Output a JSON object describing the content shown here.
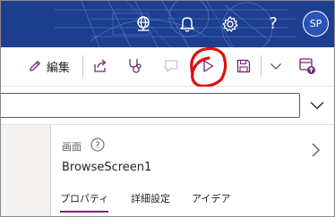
{
  "header": {
    "background": "#1e3f90",
    "icons": [
      "environment-globe-icon",
      "notification-bell-icon",
      "settings-gear-icon",
      "help-question-icon"
    ],
    "help_glyph": "?",
    "avatar_initials": "SP"
  },
  "command_bar": {
    "edit_label": "編集",
    "icons": [
      "edit-pencil-icon",
      "share-icon",
      "app-checker-stethoscope-icon",
      "comments-icon",
      "preview-play-icon",
      "save-icon",
      "more-chevron-down-icon",
      "publish-icon"
    ],
    "accent": "#742774",
    "annotation_color": "#e01010"
  },
  "formula_bar": {
    "value": "",
    "expand_icon": "chevron-down-icon"
  },
  "properties_pane": {
    "kind_label": "画面",
    "help_glyph": "?",
    "screen_name": "BrowseScreen1",
    "tabs": [
      {
        "label": "プロパティ",
        "active": true
      },
      {
        "label": "詳細設定",
        "active": false
      },
      {
        "label": "アイデア",
        "active": false
      }
    ]
  }
}
